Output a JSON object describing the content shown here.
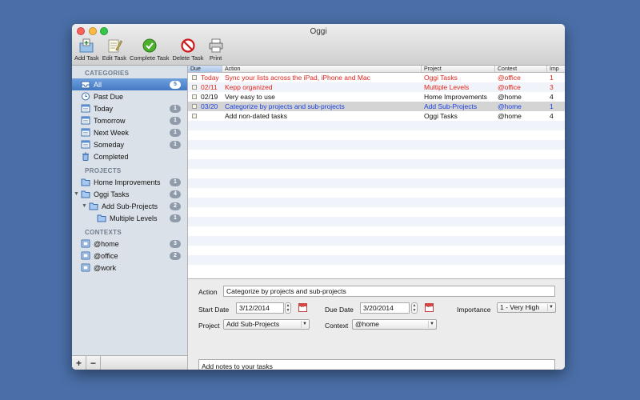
{
  "window": {
    "title": "Oggi"
  },
  "toolbar": [
    {
      "label": "Add Task",
      "icon": "add-task-icon"
    },
    {
      "label": "Edit Task",
      "icon": "edit-task-icon"
    },
    {
      "label": "Complete Task",
      "icon": "complete-task-icon"
    },
    {
      "label": "Delete Task",
      "icon": "delete-task-icon"
    },
    {
      "label": "Print",
      "icon": "print-icon"
    }
  ],
  "sidebar": {
    "categories_header": "CATEGORIES",
    "categories": [
      {
        "label": "All",
        "count": "5",
        "icon": "inbox-icon",
        "selected": true
      },
      {
        "label": "Past Due",
        "count": "",
        "icon": "clock-icon"
      },
      {
        "label": "Today",
        "count": "1",
        "icon": "calendar-icon"
      },
      {
        "label": "Tomorrow",
        "count": "1",
        "icon": "calendar-icon"
      },
      {
        "label": "Next Week",
        "count": "1",
        "icon": "calendar-icon"
      },
      {
        "label": "Someday",
        "count": "1",
        "icon": "calendar-icon"
      },
      {
        "label": "Completed",
        "count": "",
        "icon": "trash-icon"
      }
    ],
    "projects_header": "PROJECTS",
    "projects": [
      {
        "label": "Home Improvements",
        "count": "1",
        "level": 0
      },
      {
        "label": "Oggi Tasks",
        "count": "4",
        "level": 0,
        "expanded": true
      },
      {
        "label": "Add Sub-Projects",
        "count": "2",
        "level": 1,
        "expanded": true
      },
      {
        "label": "Multiple Levels",
        "count": "1",
        "level": 2
      }
    ],
    "contexts_header": "CONTEXTS",
    "contexts": [
      {
        "label": "@home",
        "count": "3"
      },
      {
        "label": "@office",
        "count": "2"
      },
      {
        "label": "@work",
        "count": ""
      }
    ],
    "add_label": "+",
    "remove_label": "−"
  },
  "table": {
    "columns": [
      "Due",
      "Action",
      "Project",
      "Context",
      "Imp"
    ],
    "rows": [
      {
        "due": "Today",
        "action": "Sync your lists across the iPad, iPhone and Mac",
        "project": "Oggi Tasks",
        "context": "@office",
        "imp": "1",
        "color": "#e2231a"
      },
      {
        "due": "02/11",
        "action": "Kepp organized",
        "project": "Multiple Levels",
        "context": "@office",
        "imp": "3",
        "color": "#e2231a"
      },
      {
        "due": "02/19",
        "action": "Very easy to use",
        "project": "Home Improvements",
        "context": "@home",
        "imp": "4",
        "color": "#111111"
      },
      {
        "due": "03/20",
        "action": "Categorize by projects and sub-projects",
        "project": "Add Sub-Projects",
        "context": "@home",
        "imp": "1",
        "color": "#1a3fe0",
        "selected": true
      },
      {
        "due": "",
        "action": "Add non-dated tasks",
        "project": "Oggi Tasks",
        "context": "@home",
        "imp": "4",
        "color": "#111111"
      }
    ]
  },
  "detail": {
    "action_label": "Action",
    "action_value": "Categorize by projects and sub-projects",
    "start_label": "Start Date",
    "start_value": "3/12/2014",
    "due_label": "Due Date",
    "due_value": "3/20/2014",
    "importance_label": "Importance",
    "importance_value": "1 - Very High",
    "project_label": "Project",
    "project_value": "Add Sub-Projects",
    "context_label": "Context",
    "context_value": "@home",
    "notes_placeholder": "Add notes to your tasks",
    "cal_day": "17"
  },
  "colors": {
    "selection": "#4379c4",
    "overdue": "#e2231a",
    "highlight": "#1a3fe0"
  }
}
